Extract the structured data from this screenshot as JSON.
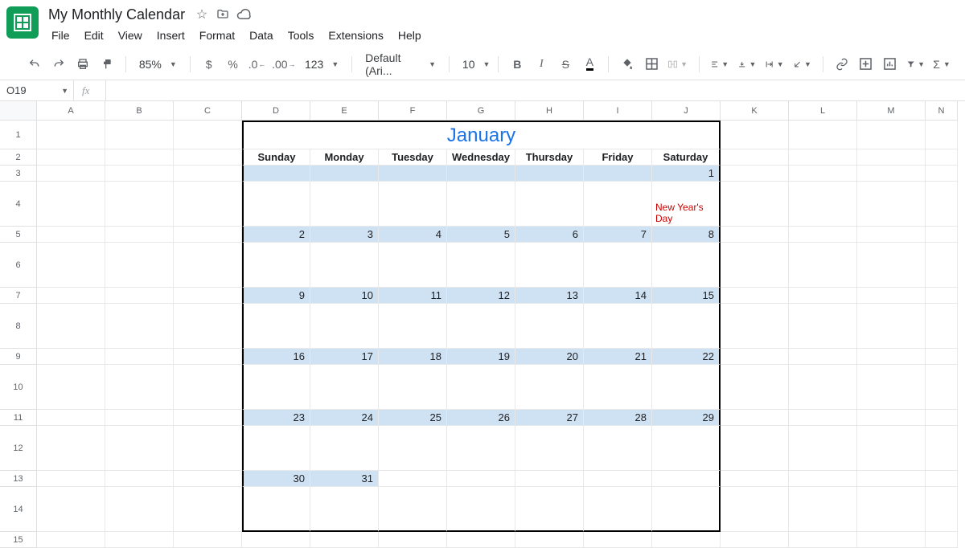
{
  "header": {
    "doc_title": "My Monthly Calendar"
  },
  "menu": {
    "file": "File",
    "edit": "Edit",
    "view": "View",
    "insert": "Insert",
    "format": "Format",
    "data": "Data",
    "tools": "Tools",
    "extensions": "Extensions",
    "help": "Help"
  },
  "toolbar": {
    "zoom": "85%",
    "currency": "$",
    "percent": "%",
    "dec_dec": ".0",
    "inc_dec": ".00",
    "numfmt": "123",
    "font": "Default (Ari...",
    "font_size": "10",
    "bold": "B",
    "italic": "I",
    "strike": "S",
    "textcolor": "A",
    "functions": "Σ"
  },
  "namebox": {
    "ref": "O19",
    "fx": "fx"
  },
  "columns": [
    "A",
    "B",
    "C",
    "D",
    "E",
    "F",
    "G",
    "H",
    "I",
    "J",
    "K",
    "L",
    "M",
    "N"
  ],
  "rows": [
    "1",
    "2",
    "3",
    "4",
    "5",
    "6",
    "7",
    "8",
    "9",
    "10",
    "11",
    "12",
    "13",
    "14",
    "15"
  ],
  "calendar": {
    "month": "January",
    "day_names": [
      "Sunday",
      "Monday",
      "Tuesday",
      "Wednesday",
      "Thursday",
      "Friday",
      "Saturday"
    ],
    "weeks": [
      [
        "",
        "",
        "",
        "",
        "",
        "",
        "1"
      ],
      [
        "2",
        "3",
        "4",
        "5",
        "6",
        "7",
        "8"
      ],
      [
        "9",
        "10",
        "11",
        "12",
        "13",
        "14",
        "15"
      ],
      [
        "16",
        "17",
        "18",
        "19",
        "20",
        "21",
        "22"
      ],
      [
        "23",
        "24",
        "25",
        "26",
        "27",
        "28",
        "29"
      ],
      [
        "30",
        "31",
        "",
        "",
        "",
        "",
        ""
      ]
    ],
    "events": [
      [
        "",
        "",
        "",
        "",
        "",
        "",
        "New Year's Day"
      ],
      [
        "",
        "",
        "",
        "",
        "",
        "",
        ""
      ],
      [
        "",
        "",
        "",
        "",
        "",
        "",
        ""
      ],
      [
        "",
        "",
        "",
        "",
        "",
        "",
        ""
      ],
      [
        "",
        "",
        "",
        "",
        "",
        "",
        ""
      ],
      [
        "",
        "",
        "",
        "",
        "",
        "",
        ""
      ]
    ]
  }
}
